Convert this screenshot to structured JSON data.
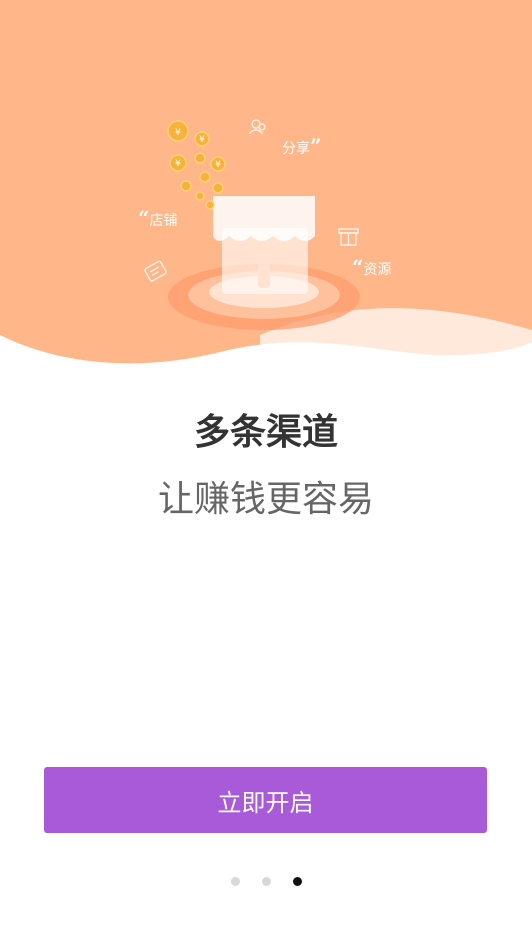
{
  "hero": {
    "labels": {
      "store": "店铺",
      "share": "分享",
      "resource": "资源"
    },
    "colors": {
      "background": "#ffb688",
      "wave_light": "#ffe9db",
      "coin": "#f7b23b"
    }
  },
  "intro": {
    "headline": "多条渠道",
    "subline": "让赚钱更容易"
  },
  "cta": {
    "label": "立即开启",
    "color": "#a85ad8"
  },
  "pager": {
    "total": 3,
    "active_index": 2,
    "active_color": "#111111",
    "inactive_color": "#d8d8d8"
  }
}
